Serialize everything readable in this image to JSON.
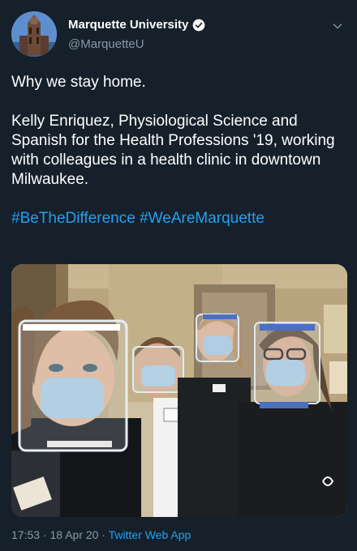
{
  "tweet": {
    "author_name": "Marquette University",
    "author_handle": "@MarquetteU",
    "line1": "Why we stay home.",
    "body": "Kelly Enriquez, Physiological Science and Spanish for the Health Professions '19, working with colleagues in a health clinic in downtown Milwaukee.",
    "hashtag1": "#BeTheDifference",
    "hashtag2": "#WeAreMarquette",
    "time": "17:53",
    "separator1": " · ",
    "date": "18 Apr 20",
    "separator2": " · ",
    "app": "Twitter Web App"
  },
  "icons": {
    "verified": "verified-badge-icon",
    "menu": "chevron-down-icon"
  },
  "colors": {
    "background": "#15202b",
    "link": "#1da1f2",
    "secondary_text": "#8899a6"
  }
}
